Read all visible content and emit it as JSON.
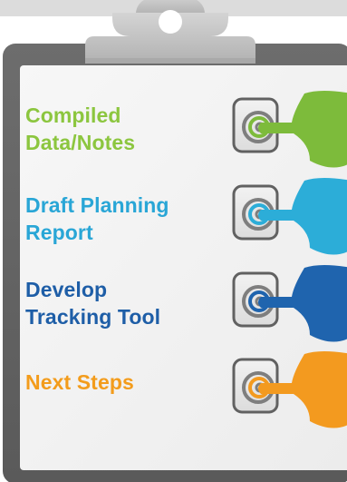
{
  "items": [
    {
      "lines": [
        "Compiled",
        "Data/Notes"
      ],
      "color": "#8CC63F",
      "tab_color": "#7DBB3B"
    },
    {
      "lines": [
        "Draft Planning",
        "Report"
      ],
      "color": "#29A6D6",
      "tab_color": "#2CADD8"
    },
    {
      "lines": [
        "Develop",
        "Tracking Tool"
      ],
      "color": "#1E5EA7",
      "tab_color": "#1F64AE"
    },
    {
      "lines": [
        "Next Steps"
      ],
      "color": "#F39C1C",
      "tab_color": "#F39A1F"
    }
  ],
  "colors": {
    "board": "#666666",
    "paper": "#F3F3F3",
    "clip": "#C6C6C6",
    "top_strip": "#DCDCDC",
    "box_border": "#616161"
  },
  "icons": [
    "clipboard-icon",
    "checkbox-icon",
    "target-icon",
    "arrow-tab-icon"
  ]
}
